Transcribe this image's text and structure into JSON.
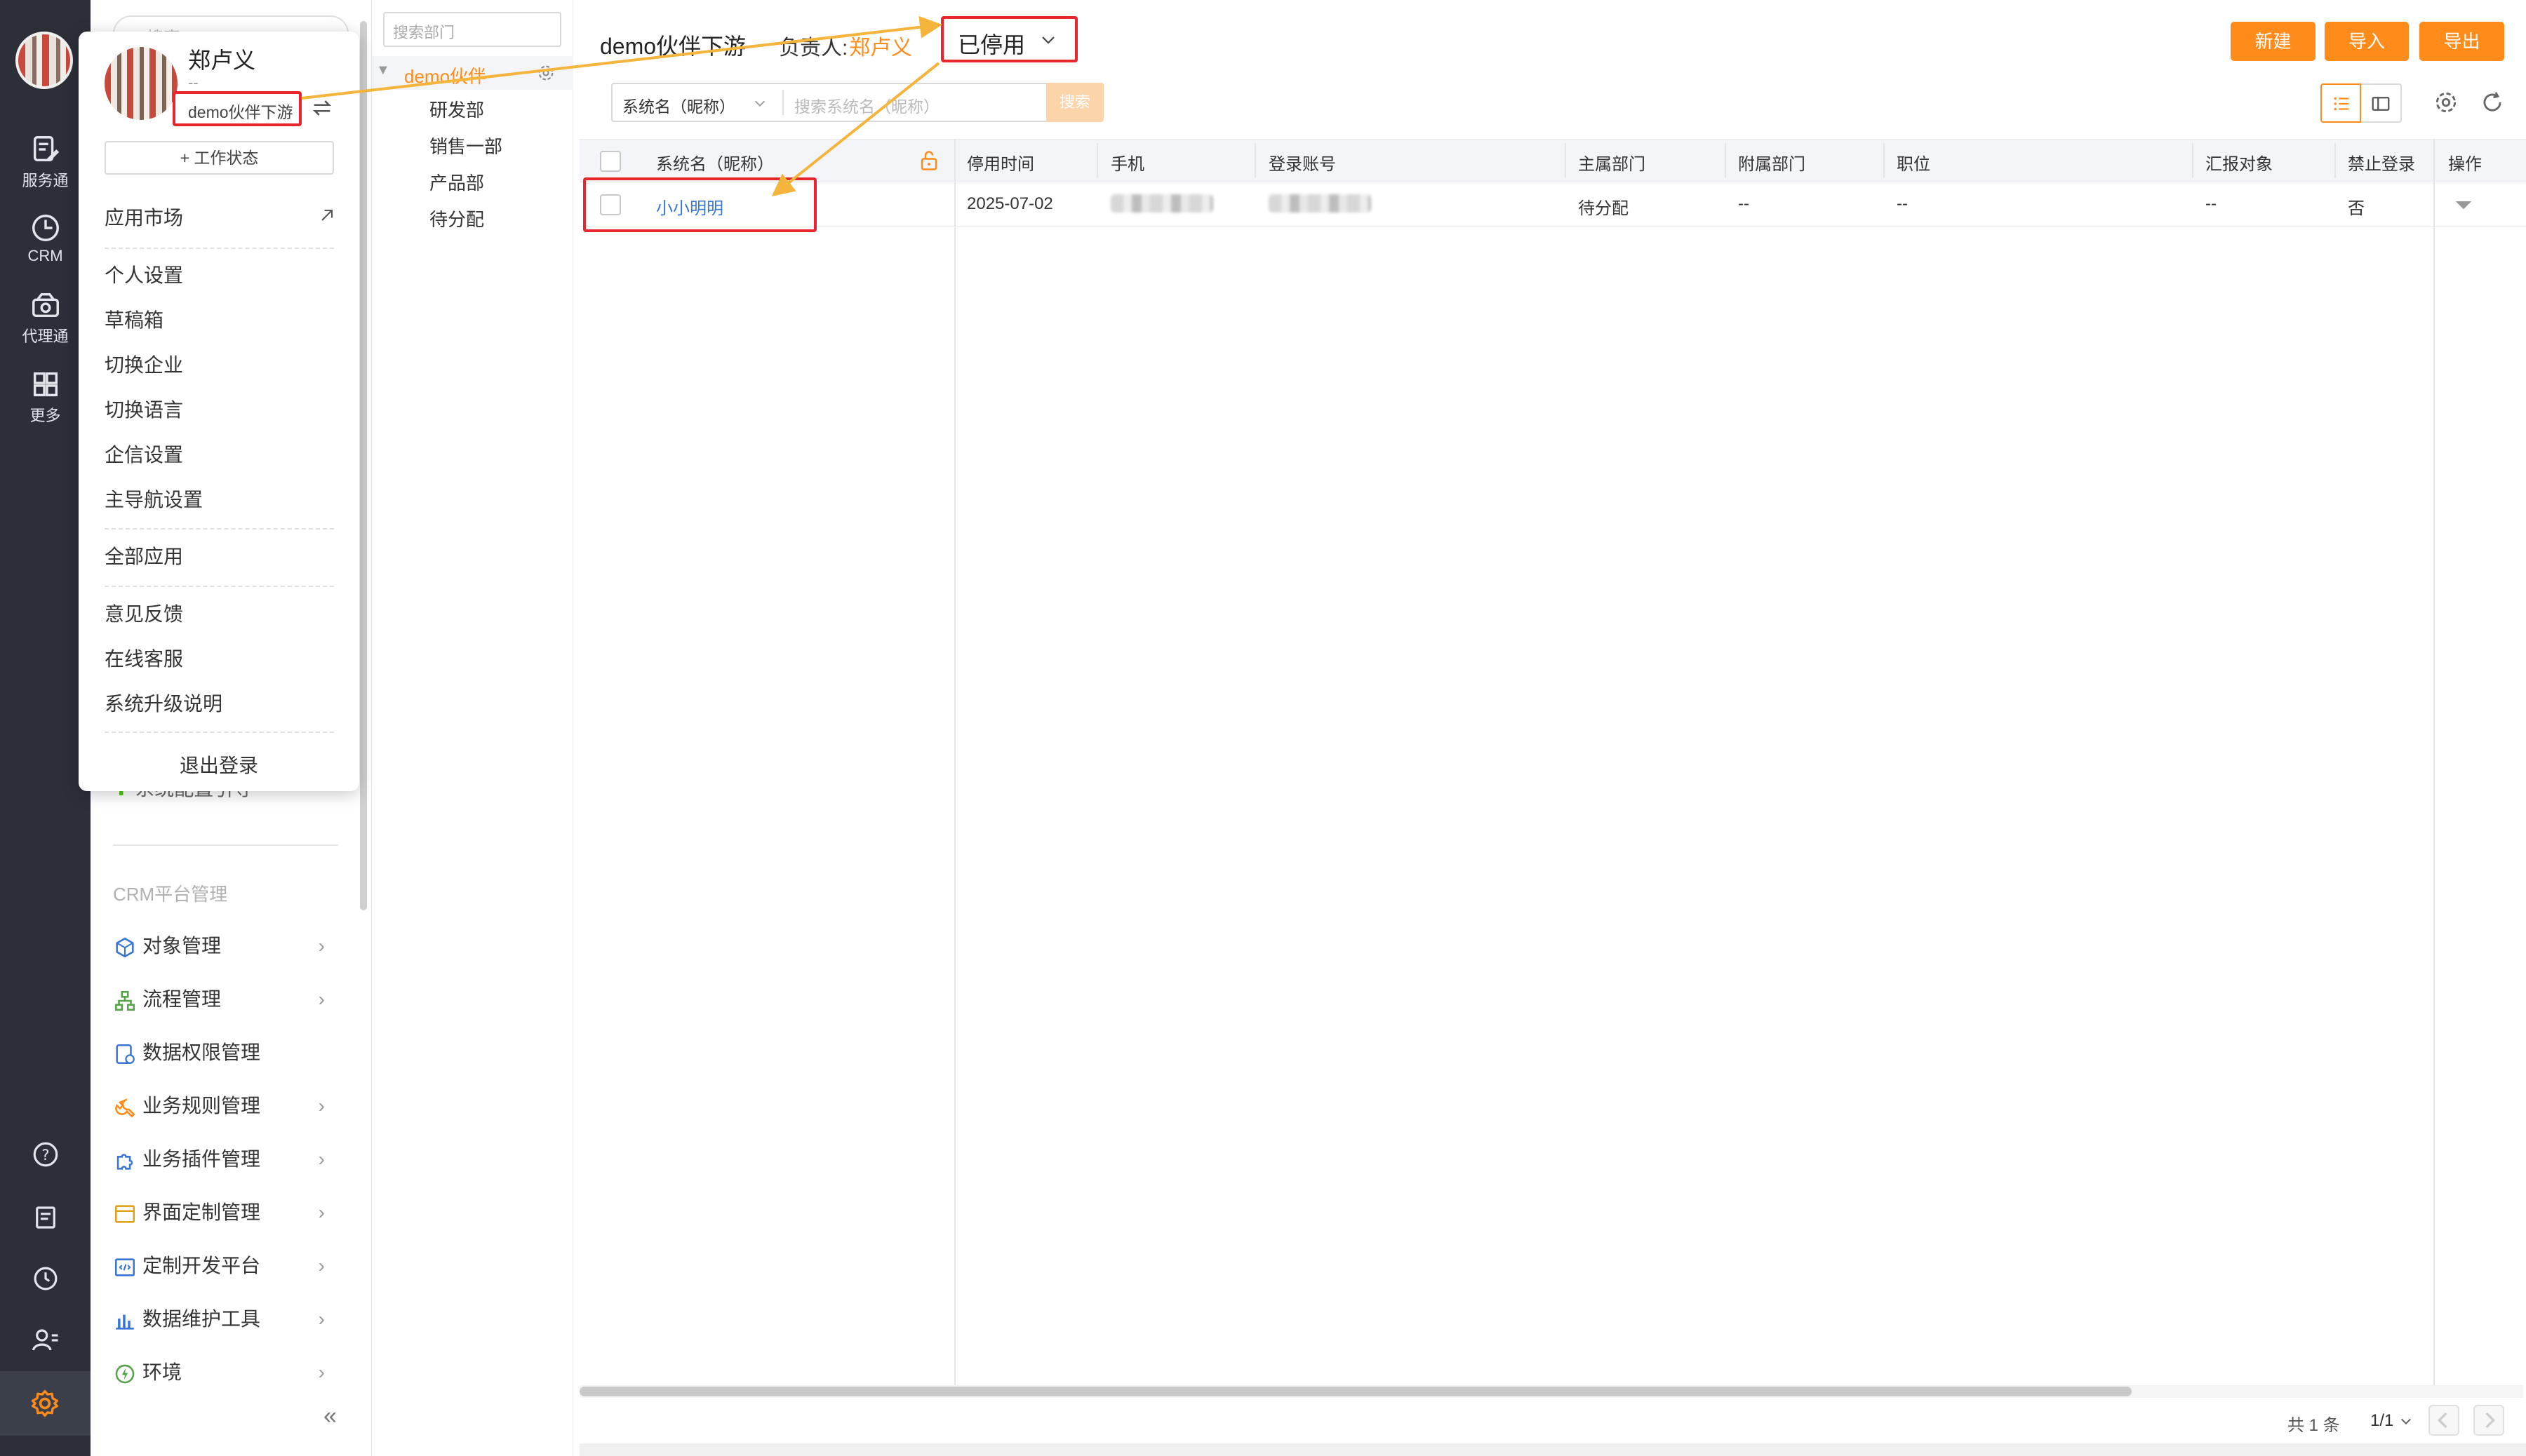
{
  "rail": {
    "items": [
      {
        "label": "服务通",
        "icon": "clipboard-edit-icon"
      },
      {
        "label": "CRM",
        "icon": "clock-chart-icon"
      },
      {
        "label": "代理通",
        "icon": "agent-icon"
      },
      {
        "label": "更多",
        "icon": "grid-icon"
      }
    ],
    "bottom_icons": [
      "help-circle-icon",
      "notes-icon",
      "history-icon",
      "contacts-icon",
      "settings-icon"
    ],
    "settings_color": "#ff8c1a"
  },
  "sidebar": {
    "search_placeholder": "搜索...",
    "partial_item": "系统配置引导",
    "section_title": "CRM平台管理",
    "items": [
      {
        "label": "对象管理",
        "icon": "object-icon",
        "has_chevron": true
      },
      {
        "label": "流程管理",
        "icon": "flow-icon",
        "has_chevron": true
      },
      {
        "label": "数据权限管理",
        "icon": "data-permission-icon",
        "has_chevron": false
      },
      {
        "label": "业务规则管理",
        "icon": "wrench-icon",
        "has_chevron": true
      },
      {
        "label": "业务插件管理",
        "icon": "puzzle-icon",
        "has_chevron": true
      },
      {
        "label": "界面定制管理",
        "icon": "layout-icon",
        "has_chevron": true
      },
      {
        "label": "定制开发平台",
        "icon": "code-icon",
        "has_chevron": true
      },
      {
        "label": "数据维护工具",
        "icon": "bar-chart-icon",
        "has_chevron": true
      },
      {
        "label": "环境",
        "icon": "env-icon",
        "has_chevron": true
      }
    ],
    "collapse_symbol": "«"
  },
  "popup": {
    "user_name": "郑卢义",
    "sub_line": "--",
    "org": "demo伙伴下游",
    "work_status_button": "+ 工作状态",
    "menu_groups": [
      [
        {
          "label": "应用市场",
          "external": true
        }
      ],
      [
        {
          "label": "个人设置"
        },
        {
          "label": "草稿箱"
        },
        {
          "label": "切换企业"
        },
        {
          "label": "切换语言"
        },
        {
          "label": "企信设置"
        },
        {
          "label": "主导航设置"
        }
      ],
      [
        {
          "label": "全部应用"
        }
      ],
      [
        {
          "label": "意见反馈"
        },
        {
          "label": "在线客服"
        },
        {
          "label": "系统升级说明"
        }
      ]
    ],
    "logout": "退出登录"
  },
  "dept_panel": {
    "search_placeholder": "搜索部门",
    "root": "demo伙伴",
    "children": [
      "研发部",
      "销售一部",
      "产品部",
      "待分配"
    ]
  },
  "header": {
    "org_title": "demo伙伴下游",
    "owner_label": "负责人:",
    "owner_name": "郑卢义",
    "status_select": "已停用",
    "buttons": {
      "new": "新建",
      "import": "导入",
      "export": "导出"
    }
  },
  "filter": {
    "field": "系统名（昵称）",
    "placeholder": "搜索系统名（昵称）",
    "search_button": "搜索"
  },
  "table": {
    "columns": [
      "系统名（昵称）",
      "停用时间",
      "手机",
      "登录账号",
      "主属部门",
      "附属部门",
      "职位",
      "汇报对象",
      "禁止登录",
      "操作"
    ],
    "rows": [
      {
        "name": "小小明明",
        "disabled_time": "2025-07-02",
        "phone": "",
        "account": "",
        "main_dept": "待分配",
        "sub_dept": "--",
        "position": "--",
        "report_to": "--",
        "forbid_login": "否"
      }
    ]
  },
  "pagination": {
    "total": "共 1 条",
    "pages": "1/1"
  },
  "colors": {
    "accent": "#ff8c1a",
    "link": "#3875d7",
    "annotation": "#e8262d",
    "arrow": "#f5b43c"
  }
}
